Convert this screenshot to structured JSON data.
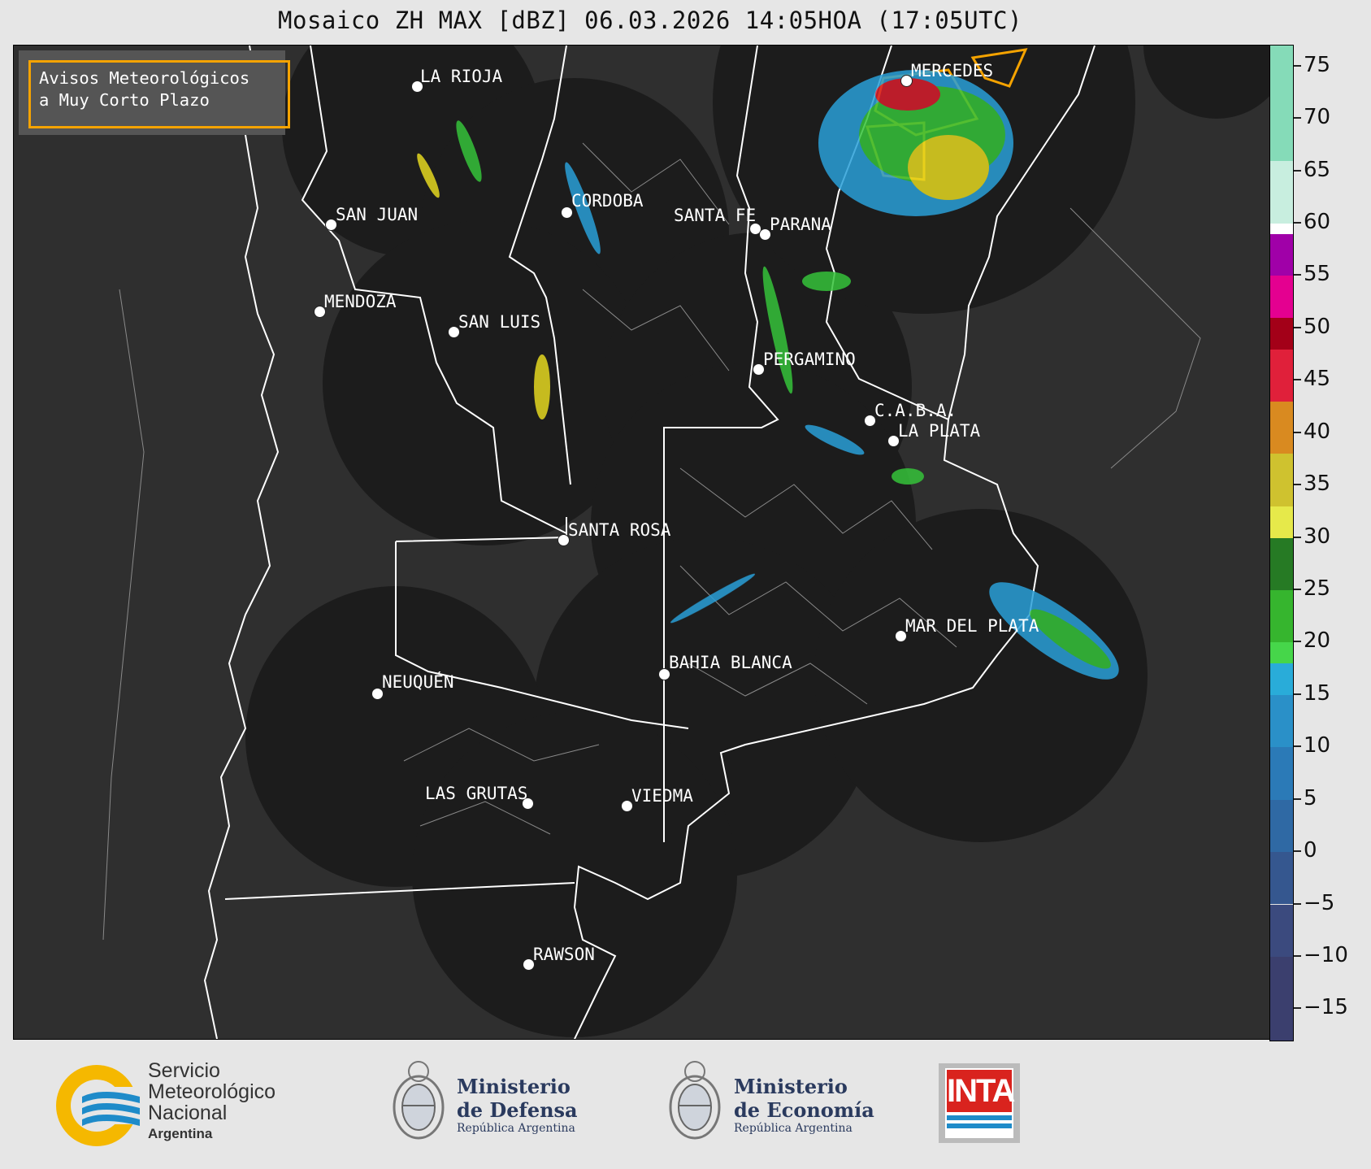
{
  "title": "Mosaico ZH MAX [dBZ] 06.03.2026 14:05HOA (17:05UTC)",
  "alert_box": {
    "line1": "Avisos Meteorológicos",
    "line2": "a Muy Corto Plazo",
    "border_color": "#f5a300"
  },
  "cities": [
    {
      "name": "LA RIOJA"
    },
    {
      "name": "SAN JUAN"
    },
    {
      "name": "CORDOBA"
    },
    {
      "name": "SANTA FE"
    },
    {
      "name": "PARANA"
    },
    {
      "name": "MERCEDES"
    },
    {
      "name": "MENDOZA"
    },
    {
      "name": "SAN LUIS"
    },
    {
      "name": "PERGAMINO"
    },
    {
      "name": "C.A.B.A."
    },
    {
      "name": "LA PLATA"
    },
    {
      "name": "SANTA ROSA"
    },
    {
      "name": "MAR DEL PLATA"
    },
    {
      "name": "BAHIA BLANCA"
    },
    {
      "name": "NEUQUÉN"
    },
    {
      "name": "LAS GRUTAS"
    },
    {
      "name": "VIEDMA"
    },
    {
      "name": "RAWSON"
    }
  ],
  "colorbar": {
    "unit": "dBZ",
    "min": -18,
    "max": 77,
    "ticks": [
      "75",
      "70",
      "65",
      "60",
      "55",
      "50",
      "45",
      "40",
      "35",
      "30",
      "25",
      "20",
      "15",
      "10",
      "5",
      "0",
      "−5",
      "−10",
      "−15"
    ]
  },
  "footer": {
    "smn": {
      "line1": "Servicio",
      "line2": "Meteorológico",
      "line3": "Nacional",
      "line4": "Argentina"
    },
    "defensa": {
      "line1": "Ministerio",
      "line2": "de Defensa",
      "line3": "República Argentina"
    },
    "economia": {
      "line1": "Ministerio",
      "line2": "de Economía",
      "line3": "República Argentina"
    },
    "inta": {
      "label": "INTA"
    }
  },
  "colors": {
    "map_bg": "#2f2f2f",
    "radar_disc": "#1c1c1c",
    "alert_orange": "#f5a300",
    "inta_red": "#d9231e",
    "smn_blue": "#1e8bc9",
    "smn_yellow": "#f5b800"
  }
}
